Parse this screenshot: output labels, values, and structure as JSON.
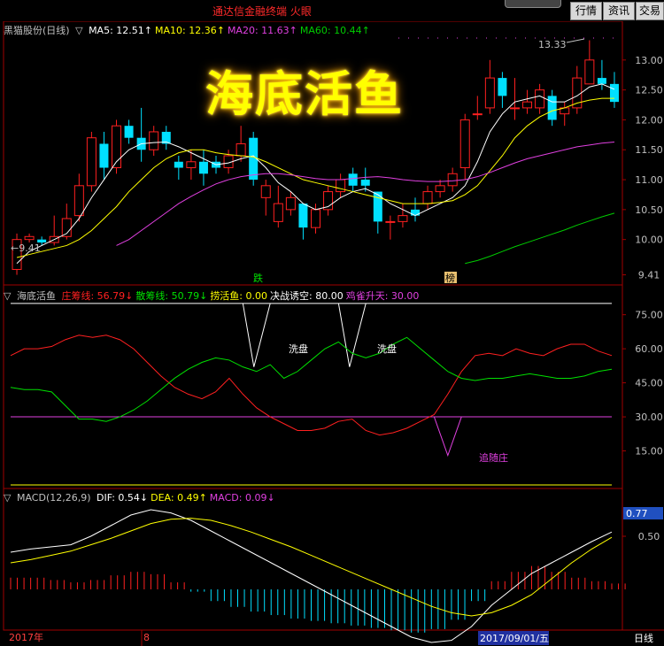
{
  "app": {
    "title": "通达信金融终端  火眼"
  },
  "toolbar": {
    "buttons": [
      "行情",
      "资讯",
      "交易"
    ]
  },
  "colors": {
    "up": "#ff2020",
    "down": "#00e0ff",
    "ma5": "#ffffff",
    "ma10": "#ffff00",
    "ma20": "#e040e0",
    "ma60": "#00cc00",
    "grid": "#a00000"
  },
  "main": {
    "stock": "黑猫股份(日线)",
    "ma_labels": [
      {
        "text": "MA5: 12.51",
        "color": "#ffffff"
      },
      {
        "text": "MA10: 12.36",
        "color": "#ffff00"
      },
      {
        "text": "MA20: 11.63",
        "color": "#e040e0"
      },
      {
        "text": "MA60: 10.44",
        "color": "#00cc00"
      }
    ],
    "overlay_title": "海底活鱼",
    "high_label": "13.33",
    "low_label": "9.41",
    "marker_left": "跌",
    "marker_right": "榜",
    "y_ticks": [
      "13.00",
      "12.50",
      "12.00",
      "11.50",
      "11.00",
      "10.50",
      "10.00",
      "9.41"
    ]
  },
  "indicator": {
    "title": "海底活鱼",
    "labels": [
      {
        "text": "庄筹线: 56.79",
        "color": "#ff2020"
      },
      {
        "text": "散筹线: 50.79",
        "color": "#00e000"
      },
      {
        "text": "捞活鱼: 0.00",
        "color": "#ffff00"
      },
      {
        "text": "决战诱空: 80.00",
        "color": "#ffffff"
      },
      {
        "text": "鸡雀升天: 30.00",
        "color": "#e040e0"
      }
    ],
    "annotations": [
      "洗盘",
      "洗盘",
      "追随庄"
    ],
    "y_ticks": [
      "75.00",
      "60.00",
      "45.00",
      "30.00",
      "15.00"
    ]
  },
  "macd": {
    "title": "MACD(12,26,9)",
    "labels": [
      {
        "text": "DIF: 0.54",
        "color": "#ffffff"
      },
      {
        "text": "DEA: 0.49",
        "color": "#ffff00"
      },
      {
        "text": "MACD: 0.09",
        "color": "#e040e0"
      }
    ],
    "current_value": "0.77",
    "y_ticks": [
      "0.50"
    ]
  },
  "footer": {
    "year": "2017年",
    "month": "8",
    "date": "2017/09/01/五",
    "period": "日线"
  },
  "chart_data": {
    "type": "candlestick",
    "candles": [
      [
        9.5,
        10.0,
        9.41,
        10.1
      ],
      [
        10.0,
        10.05,
        9.95,
        10.1
      ],
      [
        10.0,
        9.95,
        9.9,
        10.05
      ],
      [
        9.95,
        10.05,
        9.9,
        10.4
      ],
      [
        10.05,
        10.35,
        10.0,
        10.6
      ],
      [
        10.4,
        10.9,
        10.3,
        11.1
      ],
      [
        10.9,
        11.7,
        10.8,
        11.8
      ],
      [
        11.6,
        11.2,
        11.0,
        11.8
      ],
      [
        11.2,
        11.9,
        11.1,
        12.0
      ],
      [
        11.9,
        11.7,
        11.6,
        12.0
      ],
      [
        11.7,
        11.5,
        11.3,
        12.2
      ],
      [
        11.5,
        11.8,
        11.4,
        11.9
      ],
      [
        11.8,
        11.6,
        11.5,
        11.9
      ],
      [
        11.3,
        11.2,
        11.0,
        11.4
      ],
      [
        11.2,
        11.3,
        11.0,
        11.5
      ],
      [
        11.3,
        11.1,
        10.9,
        11.5
      ],
      [
        11.3,
        11.2,
        11.1,
        11.4
      ],
      [
        11.2,
        11.4,
        11.1,
        11.5
      ],
      [
        11.4,
        11.6,
        11.3,
        11.9
      ],
      [
        11.7,
        11.0,
        10.9,
        11.8
      ],
      [
        10.7,
        10.9,
        10.4,
        11.0
      ],
      [
        10.3,
        10.6,
        10.2,
        10.9
      ],
      [
        10.5,
        10.7,
        10.4,
        10.8
      ],
      [
        10.6,
        10.2,
        10.0,
        10.6
      ],
      [
        10.2,
        10.5,
        10.1,
        10.6
      ],
      [
        10.5,
        10.8,
        10.4,
        10.9
      ],
      [
        10.8,
        11.0,
        10.7,
        11.1
      ],
      [
        11.1,
        10.9,
        10.8,
        11.2
      ],
      [
        11.0,
        10.9,
        10.8,
        11.2
      ],
      [
        10.8,
        10.3,
        10.1,
        10.8
      ],
      [
        10.3,
        10.3,
        10.0,
        10.4
      ],
      [
        10.3,
        10.4,
        10.2,
        10.6
      ],
      [
        10.5,
        10.4,
        10.3,
        10.7
      ],
      [
        10.6,
        10.8,
        10.5,
        10.9
      ],
      [
        10.8,
        10.9,
        10.7,
        11.0
      ],
      [
        10.9,
        11.1,
        10.8,
        11.2
      ],
      [
        11.2,
        12.0,
        11.0,
        12.1
      ],
      [
        12.1,
        12.1,
        12.0,
        12.4
      ],
      [
        12.2,
        12.7,
        12.1,
        13.0
      ],
      [
        12.7,
        12.4,
        12.2,
        12.8
      ],
      [
        12.2,
        12.2,
        12.0,
        12.7
      ],
      [
        12.2,
        12.3,
        12.1,
        12.5
      ],
      [
        12.2,
        12.5,
        12.1,
        12.6
      ],
      [
        12.4,
        12.0,
        11.9,
        12.5
      ],
      [
        12.1,
        12.2,
        11.9,
        12.3
      ],
      [
        12.2,
        12.7,
        12.1,
        12.9
      ],
      [
        12.6,
        13.0,
        12.6,
        13.33
      ],
      [
        12.7,
        12.6,
        12.5,
        13.0
      ],
      [
        12.6,
        12.3,
        12.2,
        12.8
      ]
    ],
    "ma5": [
      9.6,
      9.8,
      9.9,
      10.0,
      10.1,
      10.35,
      10.7,
      11.0,
      11.3,
      11.5,
      11.6,
      11.62,
      11.63,
      11.55,
      11.45,
      11.35,
      11.25,
      11.28,
      11.35,
      11.4,
      11.2,
      10.95,
      10.8,
      10.6,
      10.5,
      10.55,
      10.7,
      10.8,
      10.85,
      10.75,
      10.6,
      10.5,
      10.4,
      10.5,
      10.6,
      10.7,
      10.9,
      11.3,
      11.8,
      12.1,
      12.3,
      12.35,
      12.4,
      12.3,
      12.3,
      12.4,
      12.55,
      12.6,
      12.51
    ],
    "ma10": [
      9.7,
      9.75,
      9.8,
      9.85,
      9.9,
      10.0,
      10.15,
      10.35,
      10.55,
      10.8,
      11.0,
      11.2,
      11.35,
      11.45,
      11.5,
      11.5,
      11.45,
      11.42,
      11.4,
      11.38,
      11.3,
      11.2,
      11.1,
      11.0,
      10.95,
      10.9,
      10.85,
      10.8,
      10.75,
      10.7,
      10.65,
      10.6,
      10.6,
      10.6,
      10.62,
      10.65,
      10.75,
      10.9,
      11.15,
      11.4,
      11.7,
      11.9,
      12.05,
      12.15,
      12.2,
      12.28,
      12.33,
      12.36,
      12.36
    ],
    "ma20": [
      null,
      null,
      null,
      null,
      null,
      null,
      null,
      null,
      9.9,
      10.0,
      10.15,
      10.3,
      10.45,
      10.6,
      10.72,
      10.83,
      10.93,
      11.0,
      11.05,
      11.08,
      11.1,
      11.1,
      11.08,
      11.05,
      11.02,
      11.0,
      11.0,
      11.02,
      11.04,
      11.05,
      11.03,
      11.0,
      10.98,
      10.97,
      10.97,
      10.98,
      11.0,
      11.05,
      11.12,
      11.2,
      11.28,
      11.35,
      11.4,
      11.45,
      11.5,
      11.55,
      11.58,
      11.61,
      11.63
    ],
    "ma60": [
      null,
      null,
      null,
      null,
      null,
      null,
      null,
      null,
      null,
      null,
      null,
      null,
      null,
      null,
      null,
      null,
      null,
      null,
      null,
      null,
      null,
      null,
      null,
      null,
      null,
      null,
      null,
      null,
      null,
      null,
      null,
      null,
      null,
      null,
      null,
      null,
      9.6,
      9.65,
      9.72,
      9.8,
      9.88,
      9.95,
      10.02,
      10.09,
      10.16,
      10.24,
      10.31,
      10.38,
      10.44
    ],
    "zhuang": [
      57,
      60,
      60,
      61,
      64,
      66,
      65,
      66,
      64,
      60,
      54,
      48,
      43,
      40,
      38,
      41,
      47,
      40,
      34,
      30,
      27,
      24,
      24,
      25,
      28,
      29,
      24,
      22,
      23,
      25,
      28,
      31,
      40,
      50,
      57,
      58,
      57,
      60,
      58,
      57,
      60,
      62,
      62,
      59,
      57
    ],
    "san": [
      43,
      42,
      42,
      41,
      35,
      29,
      29,
      28,
      30,
      33,
      37,
      42,
      47,
      51,
      54,
      56,
      55,
      52,
      50,
      53,
      47,
      50,
      55,
      60,
      63,
      58,
      56,
      58,
      62,
      65,
      60,
      55,
      50,
      47,
      46,
      47,
      47,
      48,
      49,
      48,
      47,
      47,
      48,
      50,
      51
    ],
    "dif": [
      0.35,
      0.38,
      0.4,
      0.42,
      0.5,
      0.6,
      0.7,
      0.75,
      0.72,
      0.65,
      0.55,
      0.45,
      0.35,
      0.25,
      0.15,
      0.05,
      -0.05,
      -0.15,
      -0.25,
      -0.35,
      -0.45,
      -0.5,
      -0.48,
      -0.35,
      -0.15,
      0.0,
      0.15,
      0.25,
      0.35,
      0.45,
      0.54
    ],
    "dea": [
      0.25,
      0.28,
      0.32,
      0.36,
      0.42,
      0.48,
      0.55,
      0.62,
      0.66,
      0.67,
      0.65,
      0.6,
      0.54,
      0.47,
      0.4,
      0.32,
      0.24,
      0.16,
      0.08,
      0.0,
      -0.08,
      -0.16,
      -0.22,
      -0.25,
      -0.22,
      -0.15,
      -0.05,
      0.1,
      0.25,
      0.38,
      0.49
    ]
  }
}
